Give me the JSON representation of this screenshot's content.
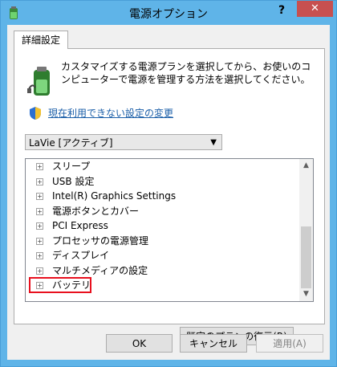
{
  "window": {
    "title": "電源オプション",
    "help_label": "?",
    "close_label": "✕"
  },
  "tab": {
    "label": "詳細設定"
  },
  "description": "カスタマイズする電源プランを選択してから、お使いのコンピューターで電源を管理する方法を選択してください。",
  "link": {
    "label": "現在利用できない設定の変更"
  },
  "plan_select": {
    "value": "LaVie [アクティブ]"
  },
  "tree": {
    "items": [
      {
        "label": "スリープ"
      },
      {
        "label": "USB 設定"
      },
      {
        "label": "Intel(R) Graphics Settings"
      },
      {
        "label": "電源ボタンとカバー"
      },
      {
        "label": "PCI Express"
      },
      {
        "label": "プロセッサの電源管理"
      },
      {
        "label": "ディスプレイ"
      },
      {
        "label": "マルチメディアの設定"
      },
      {
        "label": "バッテリ",
        "highlighted": true
      }
    ],
    "expander_glyph": "+"
  },
  "buttons": {
    "restore": "既定のプランの復元(R)",
    "ok": "OK",
    "cancel": "キャンセル",
    "apply": "適用(A)"
  },
  "colors": {
    "titlebar": "#5fb4e8",
    "close": "#c75050",
    "link": "#1a5ea8",
    "highlight": "#e8101e"
  },
  "icons": {
    "app": "battery-plug-icon",
    "panel": "battery-plug-icon",
    "link": "uac-shield-icon"
  }
}
